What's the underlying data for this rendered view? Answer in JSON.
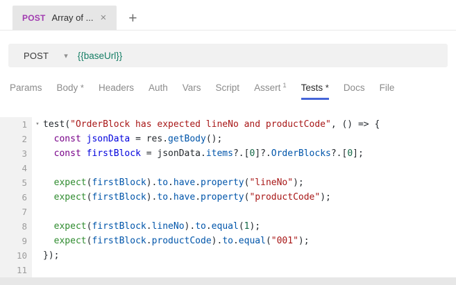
{
  "tabbar": {
    "tab": {
      "method": "POST",
      "title": "Array of ...",
      "close_icon": "×"
    },
    "new_tab_icon": "+"
  },
  "request_bar": {
    "method": "POST",
    "dropdown_icon": "▾",
    "url": "{{baseUrl}}",
    "url_color": "#147d64"
  },
  "nav": {
    "active_underline_color": "#4565d8",
    "tabs": [
      {
        "label": "Params"
      },
      {
        "label": "Body",
        "mark": "*"
      },
      {
        "label": "Headers"
      },
      {
        "label": "Auth"
      },
      {
        "label": "Vars"
      },
      {
        "label": "Script"
      },
      {
        "label": "Assert",
        "sup": "1"
      },
      {
        "label": "Tests",
        "mark": "*",
        "active": true
      },
      {
        "label": "Docs"
      },
      {
        "label": "File"
      }
    ]
  },
  "editor": {
    "fold_icon": "▾",
    "token_colors": {
      "pln": "#24292e",
      "kw": "#770088",
      "def": "#0000dd",
      "var2": "#0055aa",
      "prop": "#0055aa",
      "str": "#a81717",
      "num": "#116644",
      "grn": "#2e8b2e"
    },
    "lines": [
      {
        "no": "1",
        "fold": true,
        "tokens": [
          [
            "test",
            "pln"
          ],
          [
            "(",
            "pln"
          ],
          [
            "\"OrderBlock has expected lineNo and productCode\"",
            "str"
          ],
          [
            ", () => {",
            "pln"
          ]
        ]
      },
      {
        "no": "2",
        "tokens": [
          [
            "  ",
            "pln"
          ],
          [
            "const",
            "kw"
          ],
          [
            " ",
            "pln"
          ],
          [
            "jsonData",
            "def"
          ],
          [
            " = res.",
            "pln"
          ],
          [
            "getBody",
            "prop"
          ],
          [
            "();",
            "pln"
          ]
        ]
      },
      {
        "no": "3",
        "tokens": [
          [
            "  ",
            "pln"
          ],
          [
            "const",
            "kw"
          ],
          [
            " ",
            "pln"
          ],
          [
            "firstBlock",
            "def"
          ],
          [
            " = jsonData.",
            "pln"
          ],
          [
            "items",
            "prop"
          ],
          [
            "?.[",
            "pln"
          ],
          [
            "0",
            "num"
          ],
          [
            "]?.",
            "pln"
          ],
          [
            "OrderBlocks",
            "prop"
          ],
          [
            "?.[",
            "pln"
          ],
          [
            "0",
            "num"
          ],
          [
            "];",
            "pln"
          ]
        ]
      },
      {
        "no": "4",
        "tokens": []
      },
      {
        "no": "5",
        "tokens": [
          [
            "  ",
            "pln"
          ],
          [
            "expect",
            "grn"
          ],
          [
            "(",
            "pln"
          ],
          [
            "firstBlock",
            "var2"
          ],
          [
            ").",
            "pln"
          ],
          [
            "to",
            "prop"
          ],
          [
            ".",
            "pln"
          ],
          [
            "have",
            "prop"
          ],
          [
            ".",
            "pln"
          ],
          [
            "property",
            "prop"
          ],
          [
            "(",
            "pln"
          ],
          [
            "\"lineNo\"",
            "str"
          ],
          [
            ");",
            "pln"
          ]
        ]
      },
      {
        "no": "6",
        "tokens": [
          [
            "  ",
            "pln"
          ],
          [
            "expect",
            "grn"
          ],
          [
            "(",
            "pln"
          ],
          [
            "firstBlock",
            "var2"
          ],
          [
            ").",
            "pln"
          ],
          [
            "to",
            "prop"
          ],
          [
            ".",
            "pln"
          ],
          [
            "have",
            "prop"
          ],
          [
            ".",
            "pln"
          ],
          [
            "property",
            "prop"
          ],
          [
            "(",
            "pln"
          ],
          [
            "\"productCode\"",
            "str"
          ],
          [
            ");",
            "pln"
          ]
        ]
      },
      {
        "no": "7",
        "tokens": []
      },
      {
        "no": "8",
        "tokens": [
          [
            "  ",
            "pln"
          ],
          [
            "expect",
            "grn"
          ],
          [
            "(",
            "pln"
          ],
          [
            "firstBlock",
            "var2"
          ],
          [
            ".",
            "pln"
          ],
          [
            "lineNo",
            "prop"
          ],
          [
            ").",
            "pln"
          ],
          [
            "to",
            "prop"
          ],
          [
            ".",
            "pln"
          ],
          [
            "equal",
            "prop"
          ],
          [
            "(",
            "pln"
          ],
          [
            "1",
            "num"
          ],
          [
            ");",
            "pln"
          ]
        ]
      },
      {
        "no": "9",
        "tokens": [
          [
            "  ",
            "pln"
          ],
          [
            "expect",
            "grn"
          ],
          [
            "(",
            "pln"
          ],
          [
            "firstBlock",
            "var2"
          ],
          [
            ".",
            "pln"
          ],
          [
            "productCode",
            "prop"
          ],
          [
            ").",
            "pln"
          ],
          [
            "to",
            "prop"
          ],
          [
            ".",
            "pln"
          ],
          [
            "equal",
            "prop"
          ],
          [
            "(",
            "pln"
          ],
          [
            "\"001\"",
            "str"
          ],
          [
            ");",
            "pln"
          ]
        ]
      },
      {
        "no": "10",
        "tokens": [
          [
            "});",
            "pln"
          ]
        ]
      },
      {
        "no": "11",
        "tokens": []
      }
    ]
  }
}
